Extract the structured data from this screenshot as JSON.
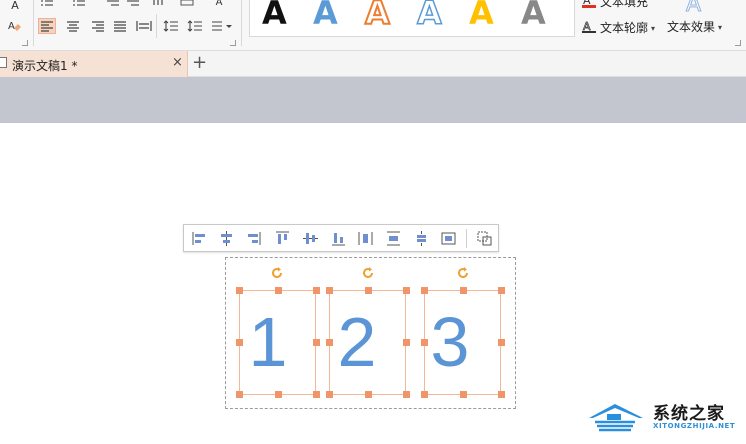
{
  "ribbon": {
    "wordart_letter": "A",
    "gallery_more": "▾",
    "text_fill_label": "文本填充",
    "text_outline_label": "文本轮廓",
    "text_effect_label": "文本效果",
    "dropdown_caret": "▾",
    "font_A": "A"
  },
  "tabs": {
    "document_title": "演示文稿1 *",
    "close_glyph": "×",
    "add_glyph": "+"
  },
  "slide": {
    "digits": [
      "1",
      "2",
      "3"
    ]
  },
  "watermark": {
    "name": "系统之家",
    "url": "XITONGZHIJIA.NET"
  },
  "colors": {
    "digit_blue": "#5b95d6",
    "handle_orange": "#f0956a",
    "rotate_orange": "#f0a030",
    "tab_active": "#f6e2d5",
    "band_gray": "#c3c5cf"
  }
}
